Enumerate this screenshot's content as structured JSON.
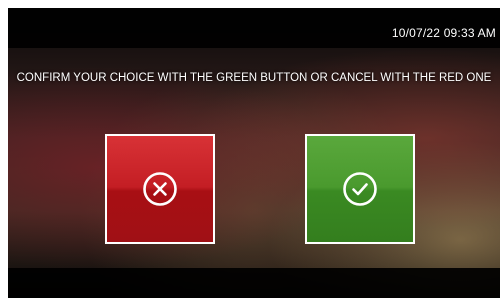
{
  "status_bar": {
    "datetime": "10/07/22 09:33 AM"
  },
  "dialog": {
    "message": "CONFIRM YOUR CHOICE WITH THE GREEN BUTTON OR CANCEL WITH THE RED ONE"
  },
  "buttons": {
    "cancel": {
      "icon": "close-circle-icon",
      "color": "#c41e24"
    },
    "confirm": {
      "icon": "check-circle-icon",
      "color": "#4a9a2e"
    }
  }
}
